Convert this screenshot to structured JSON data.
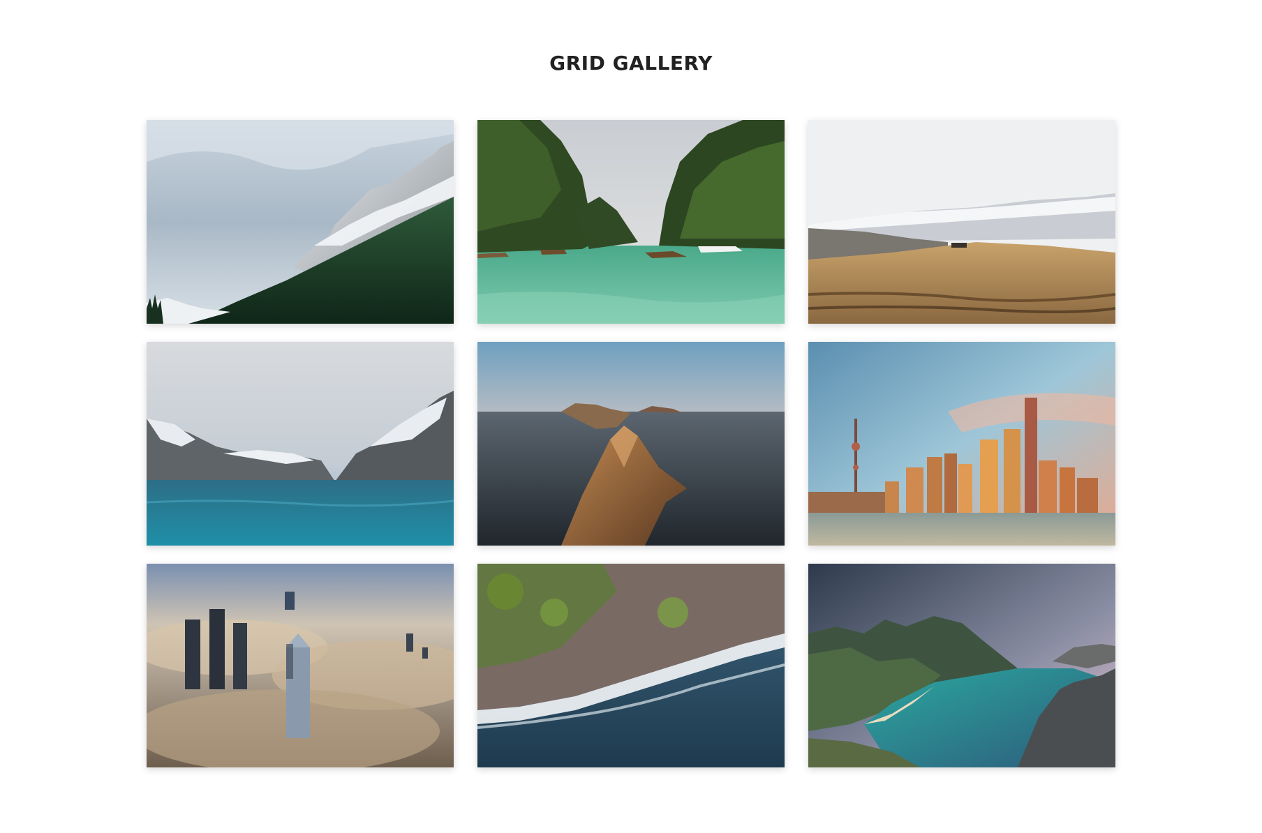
{
  "page": {
    "title": "GRID GALLERY"
  },
  "gallery": {
    "items": [
      {
        "icon": "snowy-mountain-forest-photo"
      },
      {
        "icon": "tropical-lagoon-boats-photo"
      },
      {
        "icon": "highland-meadow-photo"
      },
      {
        "icon": "mountain-lake-photo"
      },
      {
        "icon": "ocean-islands-photo"
      },
      {
        "icon": "city-skyline-sunset-photo"
      },
      {
        "icon": "skyscrapers-above-clouds-photo"
      },
      {
        "icon": "aerial-coastline-waves-photo"
      },
      {
        "icon": "fjord-beach-cliff-photo"
      }
    ]
  },
  "colors": {
    "title": "#222222",
    "background": "#ffffff"
  }
}
